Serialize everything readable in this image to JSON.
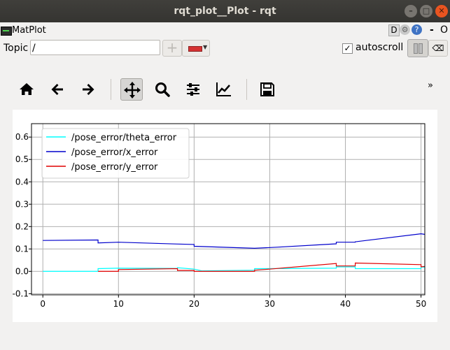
{
  "window": {
    "title": "rqt_plot__Plot - rqt"
  },
  "plugin": {
    "name": "MatPlot",
    "d_label": "D",
    "help_label": "?",
    "dash_label": "-",
    "o_label": "O"
  },
  "topic": {
    "label": "Topic",
    "value": "/"
  },
  "autoscroll": {
    "label": "autoscroll",
    "checked": true,
    "check_glyph": "✓"
  },
  "toolbar": {
    "items": [
      "home-icon",
      "back-arrow-icon",
      "forward-arrow-icon",
      "pan-icon",
      "zoom-icon",
      "subplots-config-icon",
      "edit-axis-icon",
      "save-icon"
    ],
    "active": "pan-icon",
    "overflow_label": "»"
  },
  "colors": {
    "theta": "#00ffff",
    "x": "#0000cc",
    "y": "#e00000"
  },
  "chart_data": {
    "type": "line",
    "title": "",
    "xlabel": "",
    "ylabel": "",
    "xlim": [
      -1.5,
      50.5
    ],
    "ylim": [
      -0.105,
      0.66
    ],
    "xticks": [
      0,
      10,
      20,
      30,
      40,
      50
    ],
    "yticks": [
      -0.1,
      0.0,
      0.1,
      0.2,
      0.3,
      0.4,
      0.5,
      0.6
    ],
    "ytick_labels": [
      "-0.1",
      "0.0",
      "0.1",
      "0.2",
      "0.3",
      "0.4",
      "0.5",
      "0.6"
    ],
    "grid": true,
    "legend_position": "top-left",
    "series": [
      {
        "name": "/pose_error/theta_error",
        "color": "#00ffff",
        "points": [
          [
            0,
            0.0
          ],
          [
            7.3,
            0.0
          ],
          [
            7.3,
            0.012
          ],
          [
            10,
            0.014
          ],
          [
            17.8,
            0.013
          ],
          [
            17.8,
            0.016
          ],
          [
            20,
            0.01
          ],
          [
            21,
            0.002
          ],
          [
            28,
            0.005
          ],
          [
            28,
            0.012
          ],
          [
            30,
            0.012
          ],
          [
            38.8,
            0.014
          ],
          [
            38.8,
            0.02
          ],
          [
            41.3,
            0.02
          ],
          [
            41.3,
            0.012
          ],
          [
            50,
            0.012
          ],
          [
            50,
            0.02
          ],
          [
            50.5,
            0.018
          ]
        ]
      },
      {
        "name": "/pose_error/x_error",
        "color": "#0000cc",
        "points": [
          [
            0,
            0.138
          ],
          [
            7.3,
            0.14
          ],
          [
            7.3,
            0.127
          ],
          [
            10,
            0.13
          ],
          [
            17.8,
            0.122
          ],
          [
            20,
            0.12
          ],
          [
            20,
            0.112
          ],
          [
            28,
            0.103
          ],
          [
            31,
            0.108
          ],
          [
            38.8,
            0.123
          ],
          [
            38.8,
            0.13
          ],
          [
            41.3,
            0.13
          ],
          [
            41.3,
            0.132
          ],
          [
            50,
            0.168
          ],
          [
            50.5,
            0.165
          ]
        ]
      },
      {
        "name": "/pose_error/y_error",
        "color": "#e00000",
        "points": [
          [
            7.3,
            0.0
          ],
          [
            10,
            0.0
          ],
          [
            10,
            0.008
          ],
          [
            17.8,
            0.012
          ],
          [
            17.8,
            0.004
          ],
          [
            20,
            0.004
          ],
          [
            20,
            0.0
          ],
          [
            28,
            0.0
          ],
          [
            28,
            0.005
          ],
          [
            30,
            0.01
          ],
          [
            38.8,
            0.035
          ],
          [
            38.8,
            0.024
          ],
          [
            41.3,
            0.024
          ],
          [
            41.3,
            0.037
          ],
          [
            50,
            0.03
          ],
          [
            50,
            0.02
          ],
          [
            50.5,
            0.022
          ]
        ]
      }
    ]
  }
}
